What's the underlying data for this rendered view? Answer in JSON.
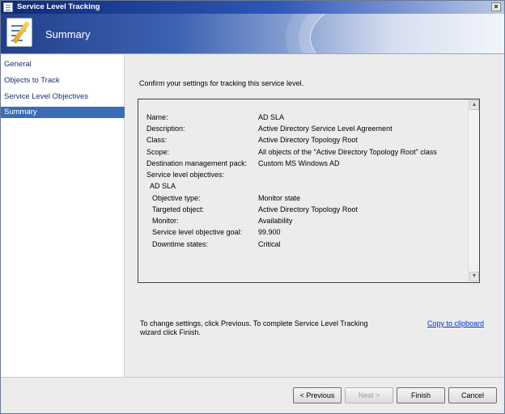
{
  "window": {
    "title": "Service Level Tracking"
  },
  "banner": {
    "heading": "Summary"
  },
  "nav": {
    "items": [
      {
        "label": "General"
      },
      {
        "label": "Objects to Track"
      },
      {
        "label": "Service Level Objectives"
      },
      {
        "label": "Summary",
        "active": true
      }
    ]
  },
  "main": {
    "intro": "Confirm your settings for tracking this service level.",
    "summary": {
      "name_key": "Name:",
      "name_val": "AD SLA",
      "desc_key": "Description:",
      "desc_val": "Active Directory Service Level Agreement",
      "class_key": "Class:",
      "class_val": "Active Directory Topology Root",
      "scope_key": "Scope:",
      "scope_val": "All objects of the \"Active Directory Topology Root\" class",
      "mp_key": "Destination management pack:",
      "mp_val": "Custom MS Windows AD",
      "slo_key": "Service level objectives:",
      "slo_name": "AD SLA",
      "objtype_key": "Objective type:",
      "objtype_val": "Monitor state",
      "target_key": "Targeted object:",
      "target_val": "Active Directory Topology Root",
      "monitor_key": "Monitor:",
      "monitor_val": "Availability",
      "goal_key": "Service level objective goal:",
      "goal_val": "99.900",
      "downtime_key": "Downtime states:",
      "downtime_val": "Critical"
    },
    "footer_text": "To change settings, click Previous. To complete Service Level Tracking wizard click Finish.",
    "copy_link": "Copy to clipboard"
  },
  "buttons": {
    "previous": "< Previous",
    "next": "Next >",
    "finish": "Finish",
    "cancel": "Cancel"
  }
}
